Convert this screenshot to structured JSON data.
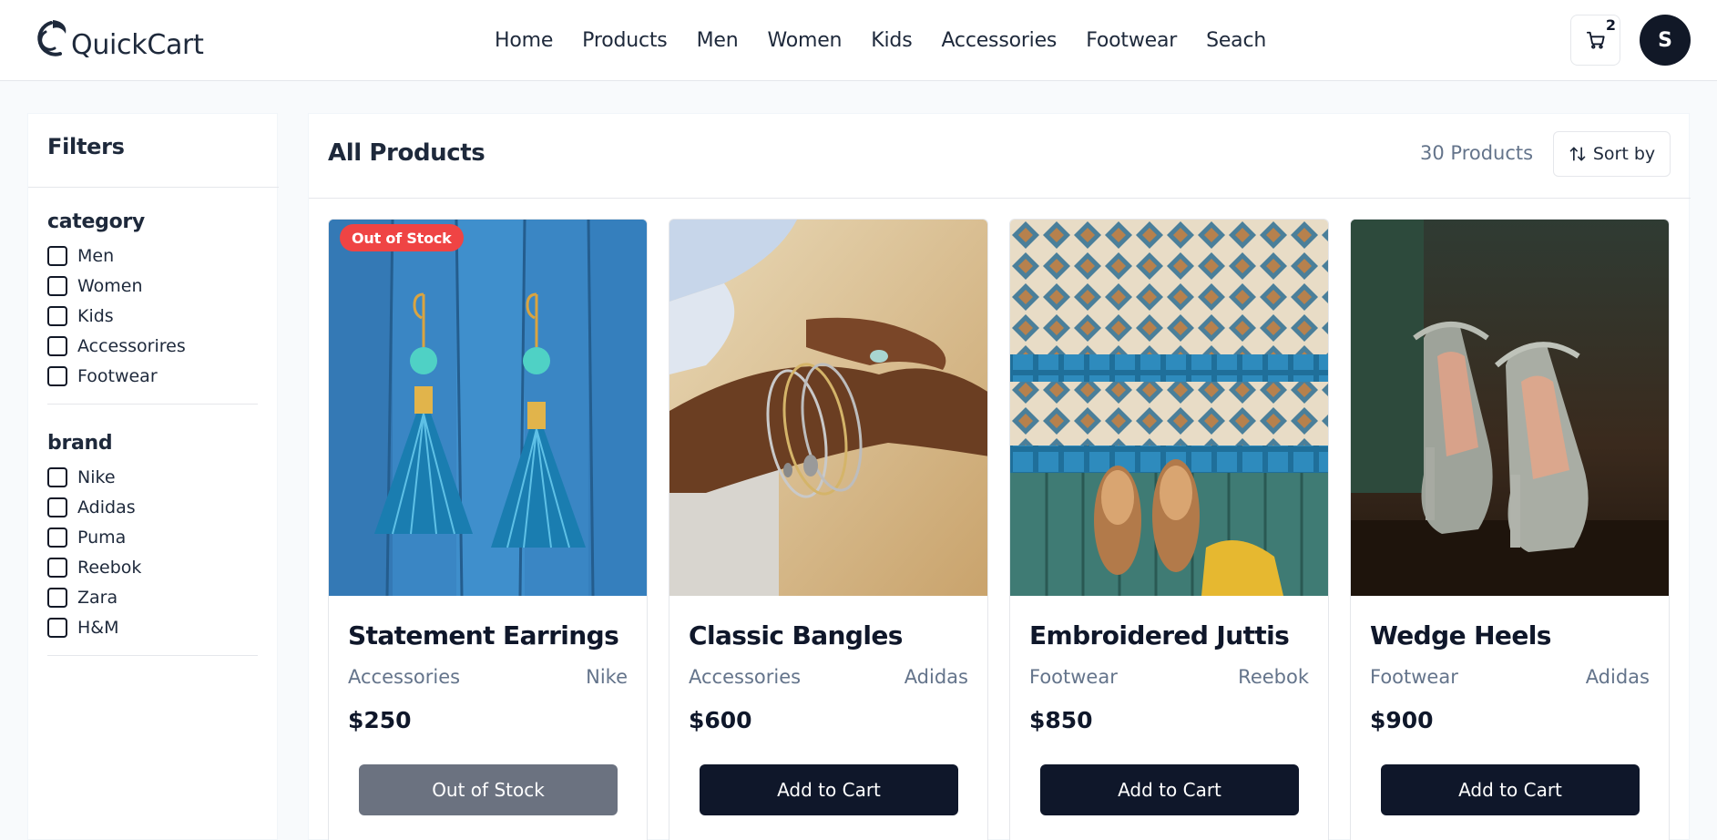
{
  "header": {
    "brand_name": "QuickCart",
    "nav": [
      "Home",
      "Products",
      "Men",
      "Women",
      "Kids",
      "Accessories",
      "Footwear",
      "Seach"
    ],
    "cart_count": "2",
    "avatar_initial": "S"
  },
  "sidebar": {
    "title": "Filters",
    "category": {
      "title": "category",
      "options": [
        "Men",
        "Women",
        "Kids",
        "Accessorires",
        "Footwear"
      ]
    },
    "brand": {
      "title": "brand",
      "options": [
        "Nike",
        "Adidas",
        "Puma",
        "Reebok",
        "Zara",
        "H&M"
      ]
    }
  },
  "main": {
    "title": "All Products",
    "count": "30 Products",
    "sort_label": "Sort by"
  },
  "products": [
    {
      "name": "Statement Earrings",
      "category": "Accessories",
      "brand": "Nike",
      "price": "$250",
      "badge": "Out of Stock",
      "button": "Out of Stock",
      "in_stock": false
    },
    {
      "name": "Classic Bangles",
      "category": "Accessories",
      "brand": "Adidas",
      "price": "$600",
      "button": "Add to Cart",
      "in_stock": true
    },
    {
      "name": "Embroidered Juttis",
      "category": "Footwear",
      "brand": "Reebok",
      "price": "$850",
      "button": "Add to Cart",
      "in_stock": true
    },
    {
      "name": "Wedge Heels",
      "category": "Footwear",
      "brand": "Adidas",
      "price": "$900",
      "button": "Add to Cart",
      "in_stock": true
    }
  ],
  "colors": {
    "primary": "#0f172a",
    "out_of_stock_badge": "#ef4444",
    "disabled_button": "#6b7280",
    "muted_text": "#64748b"
  },
  "icons": {
    "logo": "quickcart-logo-icon",
    "cart": "shopping-cart-icon",
    "sort": "sort-arrows-icon"
  }
}
